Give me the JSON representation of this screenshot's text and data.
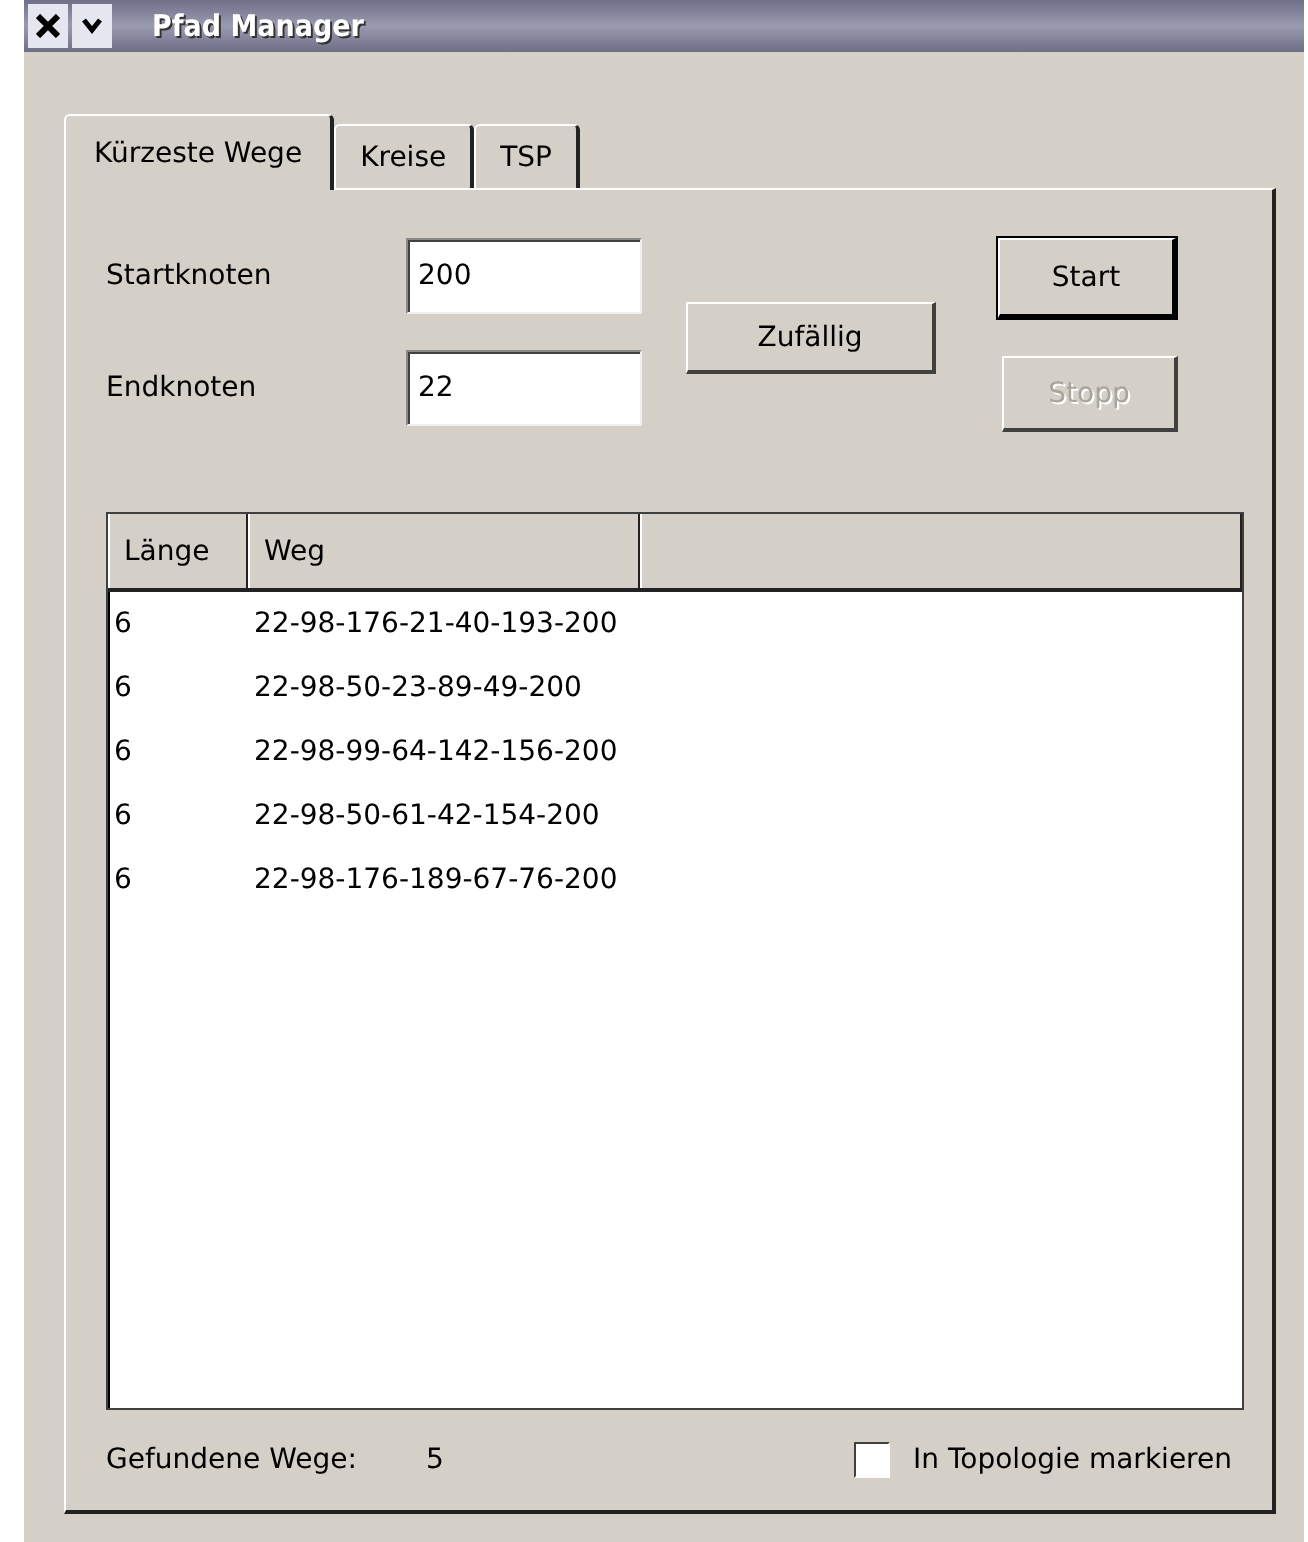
{
  "window": {
    "title": "Pfad Manager"
  },
  "tabs": [
    {
      "label": "Kürzeste Wege",
      "selected": true
    },
    {
      "label": "Kreise",
      "selected": false
    },
    {
      "label": "TSP",
      "selected": false
    }
  ],
  "form": {
    "start_node": {
      "label": "Startknoten",
      "value": "200"
    },
    "end_node": {
      "label": "Endknoten",
      "value": "22"
    }
  },
  "buttons": [
    {
      "kind": "random",
      "label": "Zufällig",
      "disabled": false,
      "default": false
    },
    {
      "kind": "start",
      "label": "Start",
      "disabled": false,
      "default": true
    },
    {
      "kind": "stop",
      "label": "Stopp",
      "disabled": true,
      "default": false
    }
  ],
  "table": {
    "columns": [
      "Länge",
      "Weg"
    ],
    "rows": [
      [
        "6",
        "22-98-176-21-40-193-200"
      ],
      [
        "6",
        "22-98-50-23-89-49-200"
      ],
      [
        "6",
        "22-98-99-64-142-156-200"
      ],
      [
        "6",
        "22-98-50-61-42-154-200"
      ],
      [
        "6",
        "22-98-176-189-67-76-200"
      ]
    ]
  },
  "footer": {
    "found_label": "Gefundene Wege:",
    "found_count": "5",
    "mark_checkbox": {
      "label": "In Topologie markieren",
      "checked": false
    }
  }
}
